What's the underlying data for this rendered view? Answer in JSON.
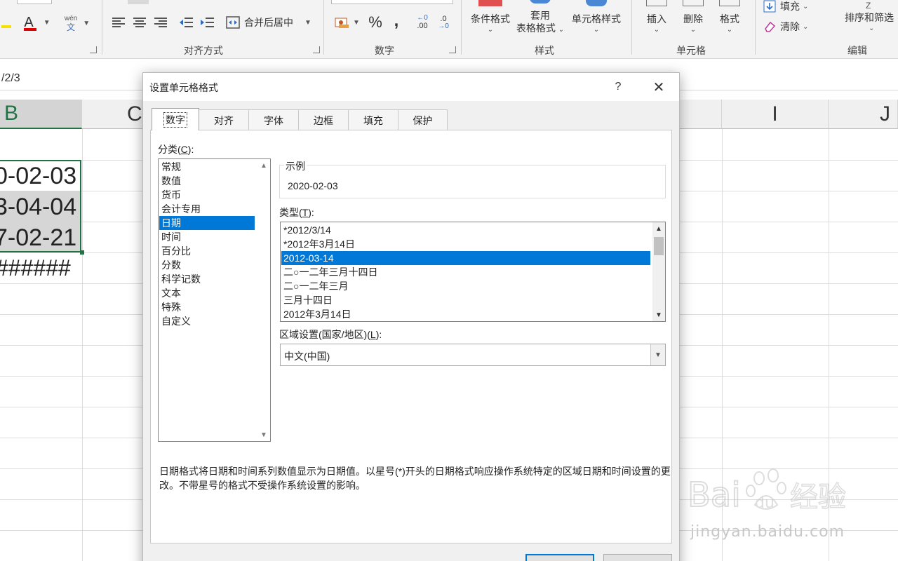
{
  "ribbon": {
    "groups": {
      "alignment": "对齐方式",
      "number": "数字",
      "styles": "样式",
      "cells": "单元格",
      "editing": "编辑"
    },
    "merge_center": "合并后居中",
    "phonetic_top": "wén",
    "phonetic_bottom": "文",
    "font_color_letter": "A",
    "percent": "%",
    "comma": ",",
    "increase_decimal": ".00",
    "decrease_decimal": ".0",
    "conditional_format": "条件格式",
    "format_as_table_1": "套用",
    "format_as_table_2": "表格格式",
    "cell_styles": "单元格样式",
    "insert": "插入",
    "delete": "删除",
    "format": "格式",
    "fill": "填充",
    "clear": "清除",
    "sort_filter": "排序和筛选",
    "accent_color": "#217346",
    "font_color": "#e00000"
  },
  "formula_bar": {
    "content": "/2/3"
  },
  "grid": {
    "columns": [
      "B",
      "C",
      "I",
      "J"
    ],
    "cells": [
      "0-02-03",
      "3-04-04",
      "7-02-21",
      "######"
    ]
  },
  "dialog": {
    "title": "设置单元格格式",
    "help": "?",
    "close": "✕",
    "tabs": [
      "数字",
      "对齐",
      "字体",
      "边框",
      "填充",
      "保护"
    ],
    "category_label": "分类(",
    "category_key": "C",
    "category_label_end": "):",
    "categories": [
      "常规",
      "数值",
      "货币",
      "会计专用",
      "日期",
      "时间",
      "百分比",
      "分数",
      "科学记数",
      "文本",
      "特殊",
      "自定义"
    ],
    "selected_category": "日期",
    "sample_legend": "示例",
    "sample_value": "2020-02-03",
    "type_label": "类型(",
    "type_key": "T",
    "type_label_end": "):",
    "types": [
      "*2012/3/14",
      "*2012年3月14日",
      "2012-03-14",
      "二○一二年三月十四日",
      "二○一二年三月",
      "三月十四日",
      "2012年3月14日"
    ],
    "selected_type": "2012-03-14",
    "locale_label": "区域设置(国家/地区)(",
    "locale_key": "L",
    "locale_label_end": "):",
    "locale_value": "中文(中国)",
    "description": "日期格式将日期和时间系列数值显示为日期值。以星号(*)开头的日期格式响应操作系统特定的区域日期和时间设置的更改。不带星号的格式不受操作系统设置的影响。",
    "selection_color": "#0078d7"
  },
  "watermark": {
    "brand": "Bai",
    "brand_mid": "du",
    "brand_suffix": "经验",
    "url": "jingyan.baidu.com"
  }
}
